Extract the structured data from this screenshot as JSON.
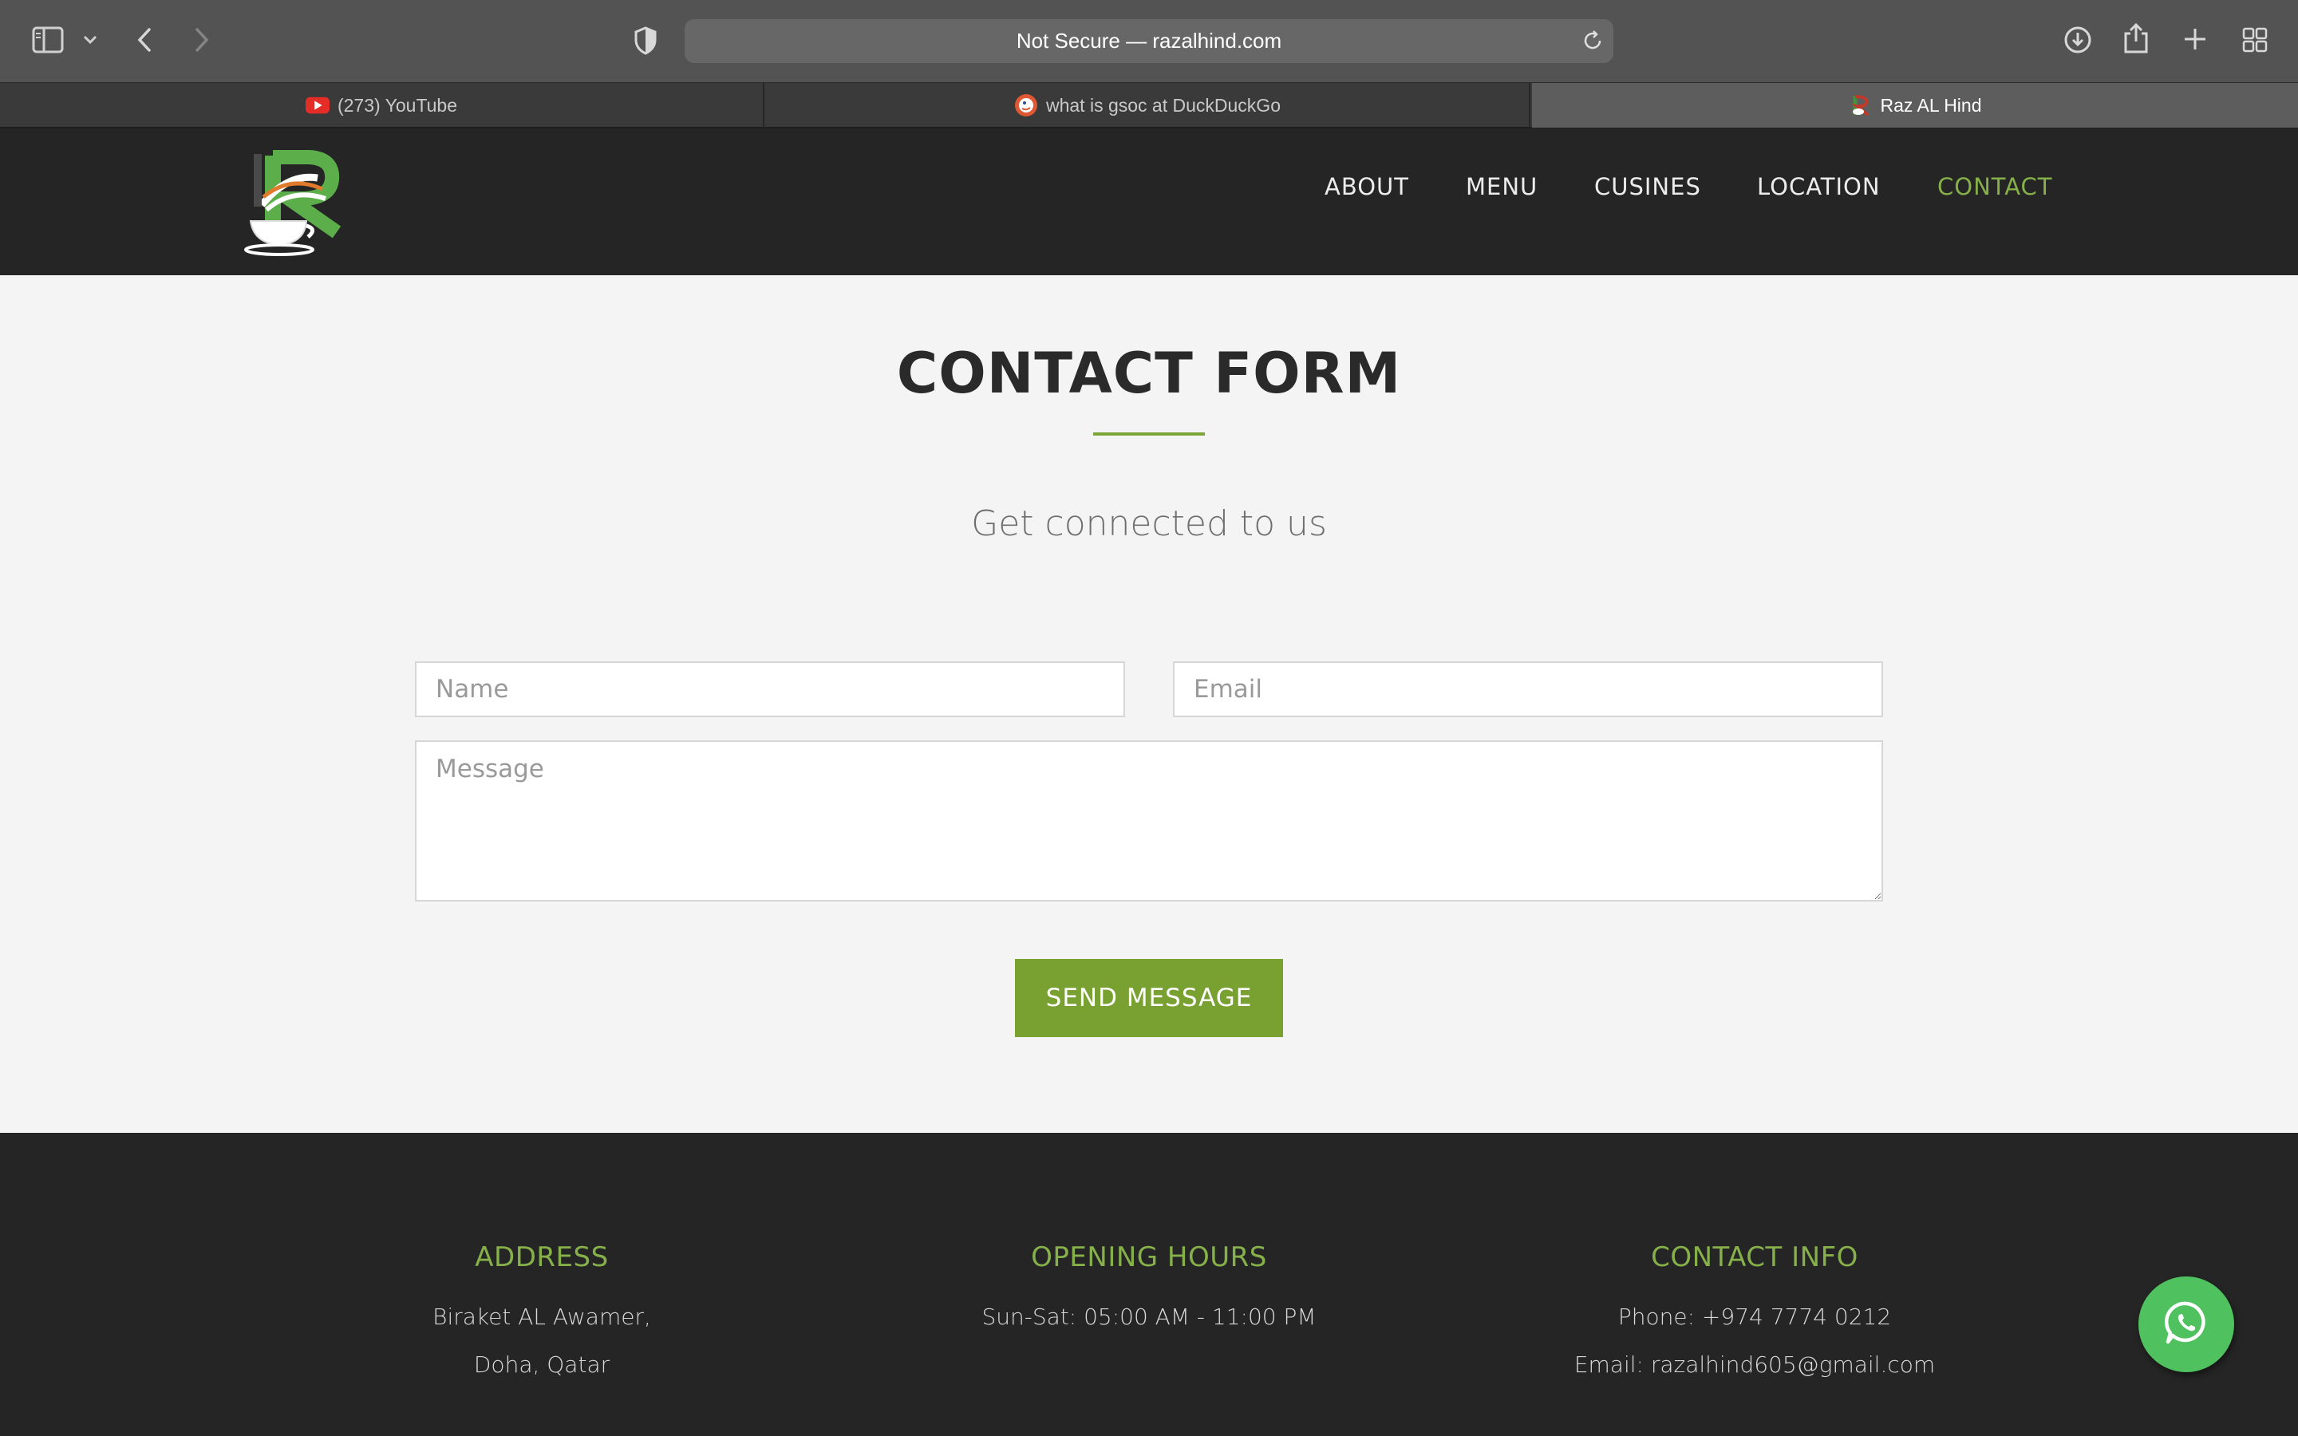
{
  "browser": {
    "url_text": "Not Secure — razalhind.com",
    "tabs": [
      {
        "title": "(273) YouTube",
        "icon": "youtube-icon"
      },
      {
        "title": "what is gsoc at DuckDuckGo",
        "icon": "duckduckgo-icon"
      },
      {
        "title": "Raz AL Hind",
        "icon": "site-favicon",
        "active": true
      }
    ]
  },
  "site": {
    "logo_alt": "Raz Al Hind",
    "nav": [
      {
        "label": "ABOUT"
      },
      {
        "label": "MENU"
      },
      {
        "label": "CUSINES"
      },
      {
        "label": "LOCATION"
      },
      {
        "label": "CONTACT",
        "active": true
      }
    ],
    "accent_color": "#7da539"
  },
  "contact": {
    "title": "CONTACT FORM",
    "subtitle": "Get connected to us",
    "name_placeholder": "Name",
    "email_placeholder": "Email",
    "message_placeholder": "Message",
    "send_label": "SEND MESSAGE"
  },
  "footer": {
    "address": {
      "heading": "ADDRESS",
      "line1": "Biraket AL Awamer,",
      "line2": "Doha, Qatar"
    },
    "hours": {
      "heading": "OPENING HOURS",
      "line1": "Sun-Sat: 05:00 AM - 11:00 PM"
    },
    "contact_info": {
      "heading": "CONTACT INFO",
      "line1": "Phone: +974 7774 0212",
      "line2": "Email: razalhind605@gmail.com"
    }
  },
  "floating": {
    "icon": "whatsapp-icon"
  }
}
